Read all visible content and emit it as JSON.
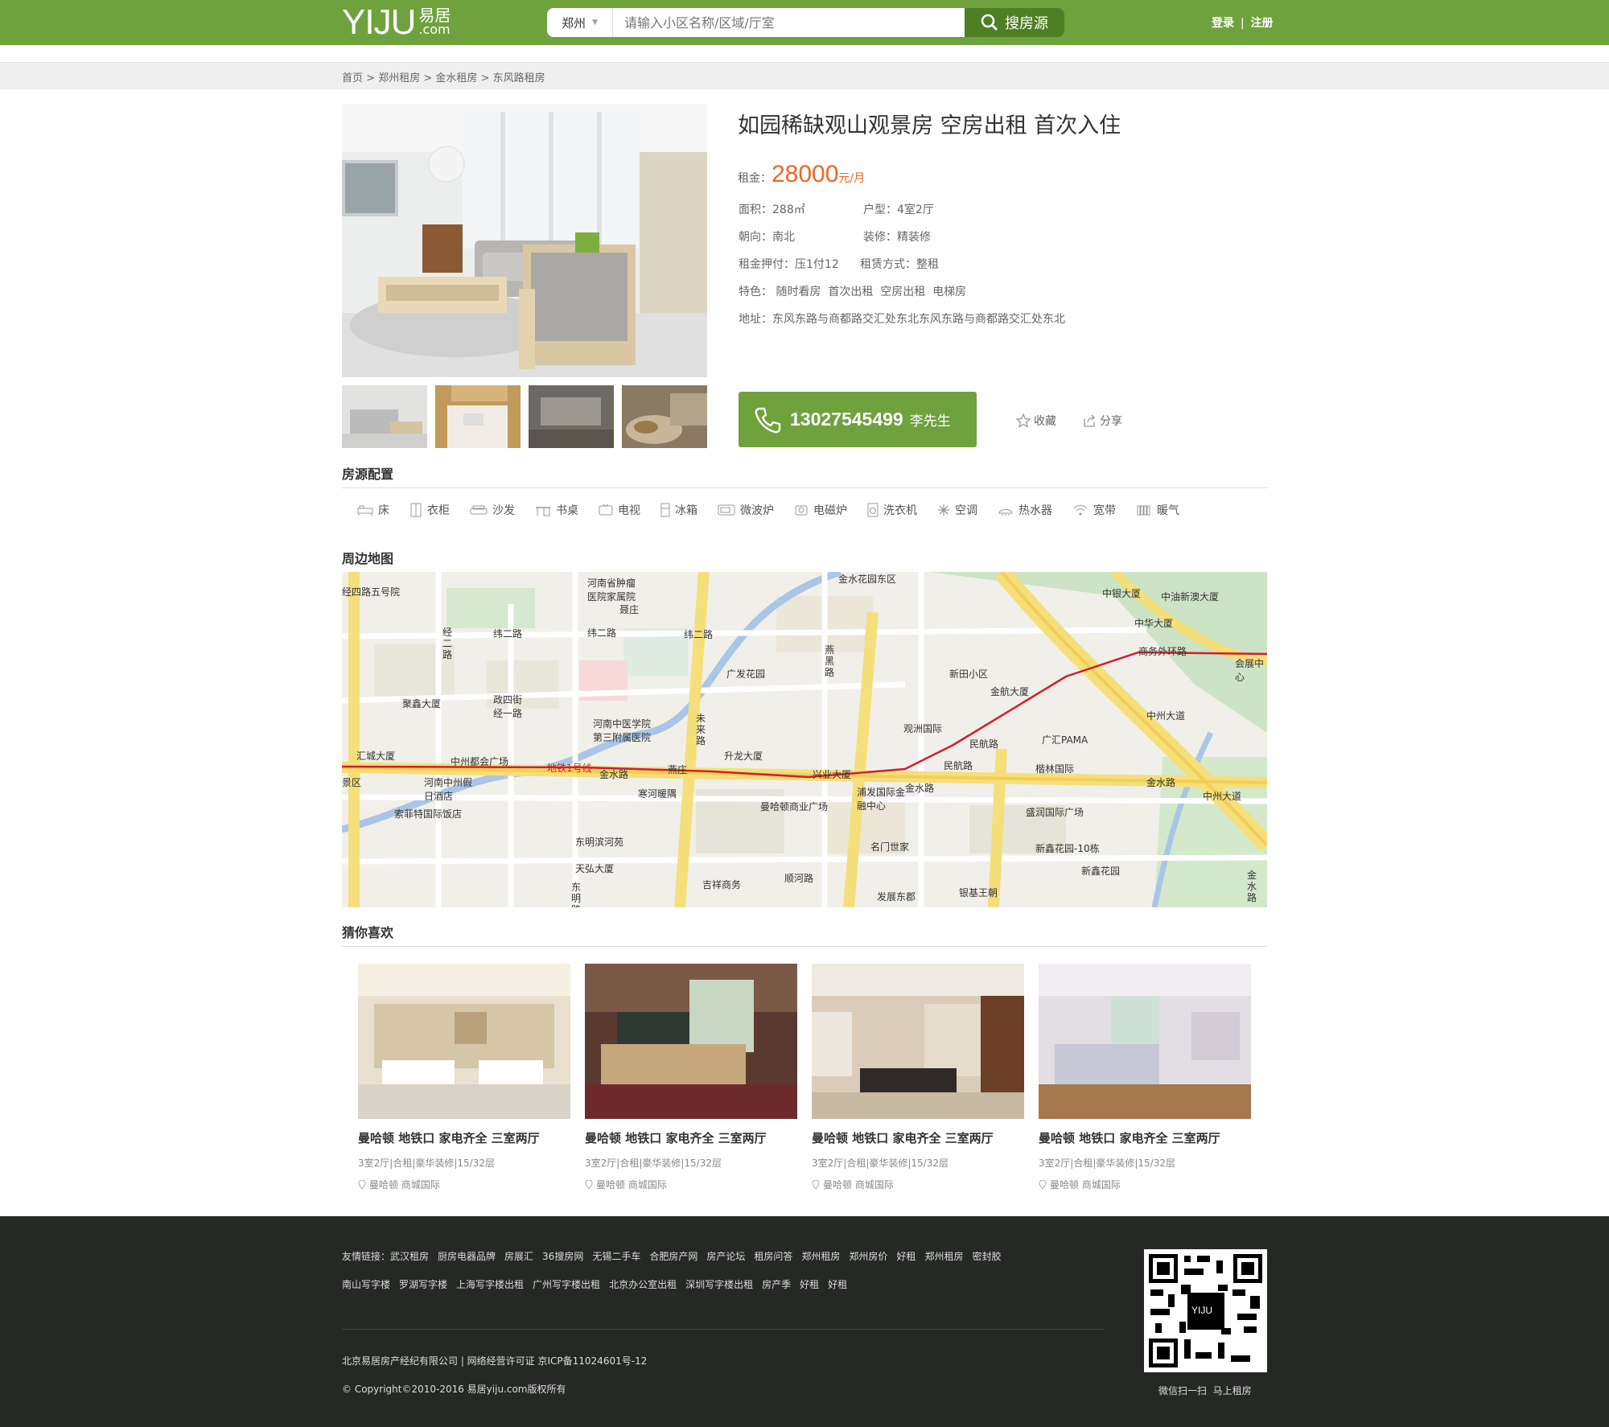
{
  "header": {
    "logo_text": "YIJU",
    "logo_cn": "易居",
    "logo_dot": ".com",
    "city": "郑州",
    "search_placeholder": "请输入小区名称/区域/厅室",
    "search_button": "搜房源",
    "login": "登录",
    "sep": "|",
    "register": "注册"
  },
  "breadcrumb": [
    {
      "label": "首页"
    },
    {
      "label": "郑州租房"
    },
    {
      "label": "金水租房"
    },
    {
      "label": "东风路租房"
    }
  ],
  "listing": {
    "title": "如园稀缺观山观景房 空房出租 首次入住",
    "rent_label": "租金：",
    "rent_value": "28000",
    "rent_unit": "元/月",
    "area": "面积：288㎡",
    "layout": "户型：4室2厅",
    "orientation": "朝向：南北",
    "decoration": "装修：精装修",
    "deposit": "租金押付：压1付12",
    "lease_type": "租赁方式：整租",
    "features": "特色： 随时看房  首次出租  空房出租  电梯房",
    "address": "地址：东风东路与商都路交汇处东北东风东路与商都路交汇处东北",
    "phone": "13027545499",
    "contact": "李先生",
    "favorite": "收藏",
    "share": "分享"
  },
  "config": {
    "heading": "房源配置",
    "items": [
      {
        "label": "床",
        "icon": "bed-icon"
      },
      {
        "label": "衣柜",
        "icon": "wardrobe-icon"
      },
      {
        "label": "沙发",
        "icon": "sofa-icon"
      },
      {
        "label": "书桌",
        "icon": "desk-icon"
      },
      {
        "label": "电视",
        "icon": "tv-icon"
      },
      {
        "label": "冰箱",
        "icon": "fridge-icon"
      },
      {
        "label": "微波炉",
        "icon": "microwave-icon"
      },
      {
        "label": "电磁炉",
        "icon": "induction-cooker-icon"
      },
      {
        "label": "洗衣机",
        "icon": "washer-icon"
      },
      {
        "label": "空调",
        "icon": "air-conditioner-icon"
      },
      {
        "label": "热水器",
        "icon": "water-heater-icon"
      },
      {
        "label": "宽带",
        "icon": "wifi-icon"
      },
      {
        "label": "暖气",
        "icon": "radiator-icon"
      }
    ]
  },
  "map": {
    "heading": "周边地图",
    "roads": [
      "纬二路",
      "纬二路",
      "纬二路",
      "经二路",
      "政四街经一路",
      "金水路",
      "金水路",
      "金水路",
      "东明路",
      "顺河路",
      "燕黑路",
      "未来路",
      "民航路",
      "商务外环路",
      "中州大道",
      "中州大道",
      "金水路",
      "经四路五号院",
      "地铁1号线"
    ],
    "pois": [
      "河南省肿瘤医院家属院",
      "金水花园东区",
      "中银大厦",
      "中油新澳大厦",
      "中华大厦",
      "会展中心",
      "聂庄",
      "广发花园",
      "新田小区",
      "金航大厦",
      "河南中医学院第三附属医院",
      "观洲国际",
      "广汇PAMA",
      "聚鑫大厦",
      "汇城大厦",
      "中州都会广场",
      "燕庄",
      "升龙大厦",
      "兴业大厦",
      "民航路",
      "楷林国际",
      "河南中州假日酒店",
      "寒河暖隅",
      "曼哈顿商业广场",
      "浦发国际金融中心",
      "盛润国际广场",
      "索菲特国际饭店",
      "东明滨河苑",
      "名门世家",
      "新鑫花园-10栋",
      "天弘大厦",
      "新鑫花园",
      "吉祥商务",
      "发展东郡",
      "银基王朝",
      "景区"
    ]
  },
  "recommend": {
    "heading": "猜你喜欢",
    "cards": [
      {
        "title": "曼哈顿 地铁口 家电齐全 三室两厅",
        "meta": "3室2厅|合租|豪华装修|15/32层",
        "location": "曼哈顿 商城国际"
      },
      {
        "title": "曼哈顿 地铁口 家电齐全 三室两厅",
        "meta": "3室2厅|合租|豪华装修|15/32层",
        "location": "曼哈顿 商城国际"
      },
      {
        "title": "曼哈顿 地铁口 家电齐全 三室两厅",
        "meta": "3室2厅|合租|豪华装修|15/32层",
        "location": "曼哈顿 商城国际"
      },
      {
        "title": "曼哈顿 地铁口 家电齐全 三室两厅",
        "meta": "3室2厅|合租|豪华装修|15/32层",
        "location": "曼哈顿 商城国际"
      }
    ]
  },
  "footer": {
    "links_row1": [
      "友情链接：武汉租房",
      "厨房电器品牌",
      "房展汇",
      "36搜房网",
      "无锡二手车",
      "合肥房产网",
      "房产论坛",
      "租房问答",
      "郑州租房",
      "郑州房价",
      "好租",
      "郑州租房",
      "密封胶"
    ],
    "links_row2": [
      "南山写字楼",
      "罗湖写字楼",
      "上海写字楼出租",
      "广州写字楼出租",
      "北京办公室出租",
      "深圳写字楼出租",
      "房产季",
      "好租",
      "好租"
    ],
    "company": "北京易居房产经纪有限公司 | 网络经营许可证 京ICP备11024601号-12",
    "copyright": "© Copyright©2010-2016 易居yiju.com版权所有",
    "qr_logo": "YIJU",
    "qr_caption": "微信扫一扫  马上租房"
  },
  "colors": {
    "brand_green": "#6fa13d",
    "price_orange": "#f26522",
    "footer_bg": "#262826"
  }
}
